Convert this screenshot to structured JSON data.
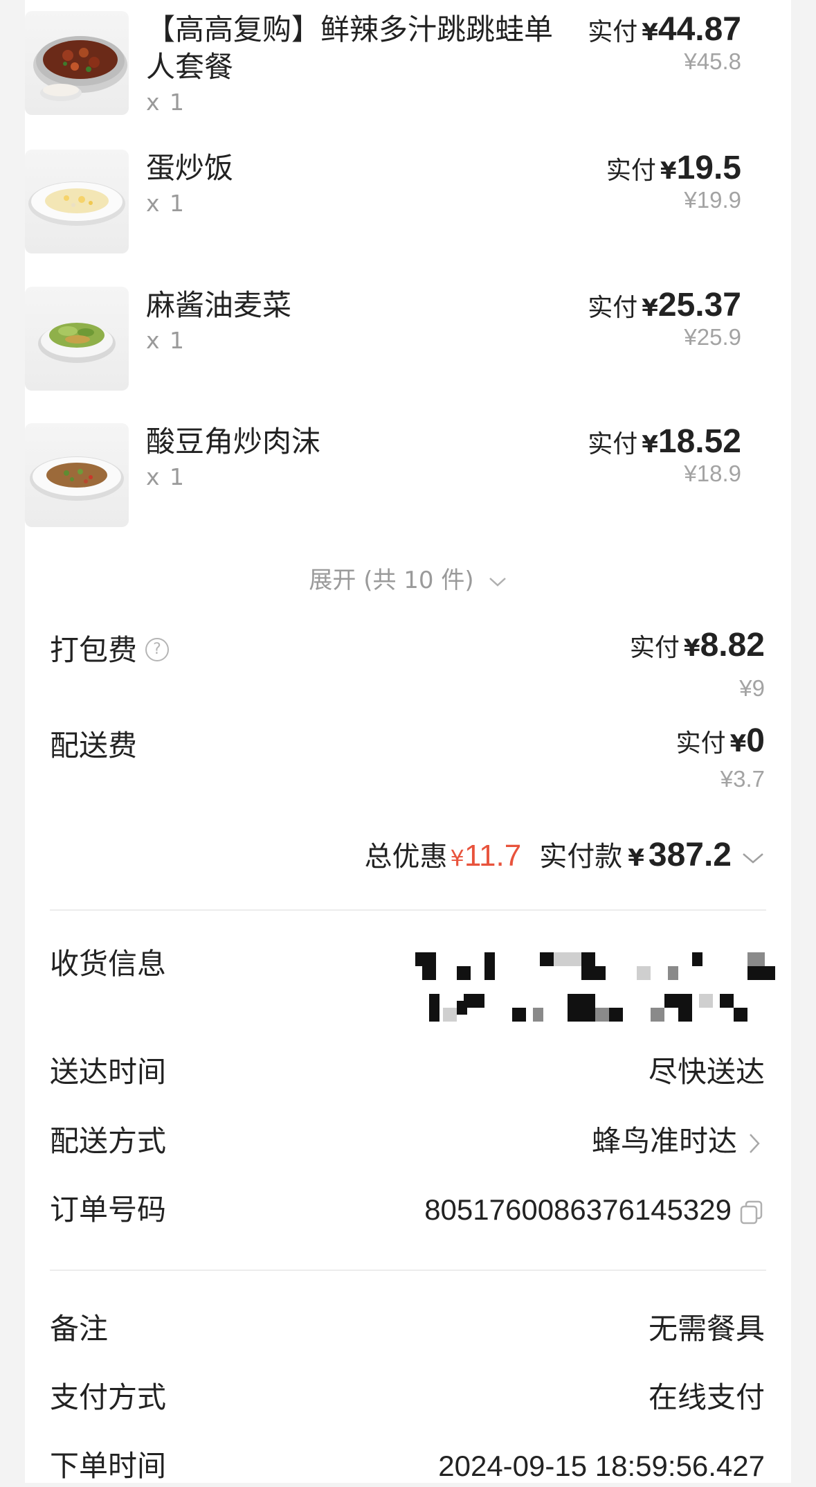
{
  "items": [
    {
      "name": "【高高复购】鲜辣多汁跳跳蛙单人套餐",
      "qty": "x 1",
      "paid_label": "实付",
      "currency": "¥",
      "paid_price": "44.87",
      "original_price": "¥45.8",
      "image_icon": "frog-hotpot-dish"
    },
    {
      "name": "蛋炒饭",
      "qty": "x 1",
      "paid_label": "实付",
      "currency": "¥",
      "paid_price": "19.5",
      "original_price": "¥19.9",
      "image_icon": "fried-rice-dish"
    },
    {
      "name": "麻酱油麦菜",
      "qty": "x 1",
      "paid_label": "实付",
      "currency": "¥",
      "paid_price": "25.37",
      "original_price": "¥25.9",
      "image_icon": "lettuce-dish"
    },
    {
      "name": "酸豆角炒肉沫",
      "qty": "x 1",
      "paid_label": "实付",
      "currency": "¥",
      "paid_price": "18.52",
      "original_price": "¥18.9",
      "image_icon": "minced-pork-dish"
    }
  ],
  "expand": {
    "label": "展开 (共 10 件)"
  },
  "fees": {
    "packing": {
      "label": "打包费",
      "help": "?",
      "paid_label": "实付",
      "currency": "¥",
      "paid_price": "8.82",
      "original_price": "¥9"
    },
    "delivery": {
      "label": "配送费",
      "paid_label": "实付",
      "currency": "¥",
      "paid_price": "0",
      "original_price": "¥3.7"
    }
  },
  "totals": {
    "discount_label": "总优惠",
    "discount_currency": "¥",
    "discount_value": "11.7",
    "paid_label": "实付款",
    "paid_currency": "¥",
    "paid_value": "387.2"
  },
  "order_info": {
    "address_label": "收货信息",
    "delivery_time_label": "送达时间",
    "delivery_time_value": "尽快送达",
    "delivery_method_label": "配送方式",
    "delivery_method_value": "蜂鸟准时达",
    "order_no_label": "订单号码",
    "order_no_value": "8051760086376145329",
    "remark_label": "备注",
    "remark_value": "无需餐具",
    "payment_label": "支付方式",
    "payment_value": "在线支付",
    "order_time_label": "下单时间",
    "order_time_value": "2024-09-15 18:59:56.427"
  },
  "colors": {
    "discount_red": "#e8533c",
    "text_primary": "#222222",
    "text_secondary": "#9a9a9a",
    "page_bg": "#f3f3f3",
    "card_bg": "#ffffff"
  }
}
